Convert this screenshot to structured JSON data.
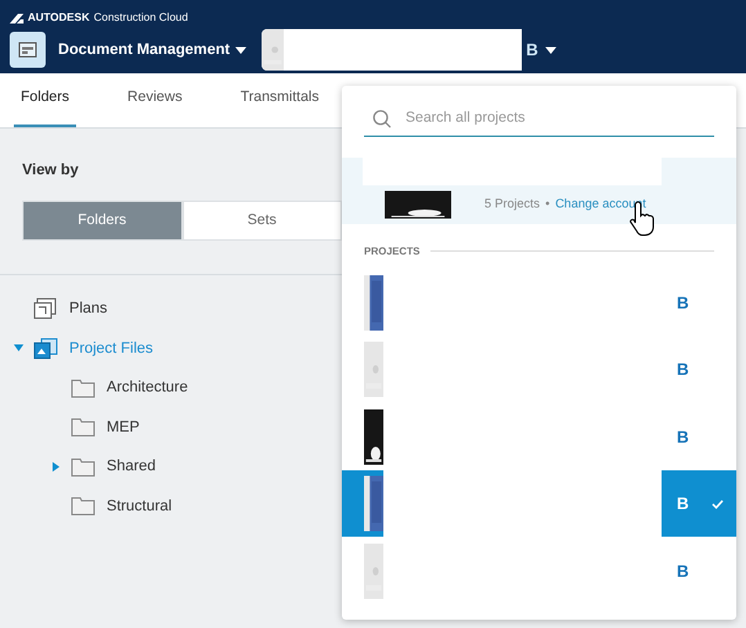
{
  "header": {
    "brand": "AUTODESK",
    "product": "Construction Cloud",
    "module": "Document Management",
    "project_name": "B"
  },
  "tabs": [
    {
      "label": "Folders",
      "selected": true
    },
    {
      "label": "Reviews",
      "selected": false
    },
    {
      "label": "Transmittals",
      "selected": false
    }
  ],
  "view_by": {
    "label": "View by",
    "options": [
      {
        "label": "Folders",
        "selected": true
      },
      {
        "label": "Sets",
        "selected": false
      }
    ]
  },
  "tree": [
    {
      "kind": "plans",
      "label": "Plans",
      "selected": false
    },
    {
      "kind": "files",
      "label": "Project Files",
      "selected": true,
      "expanded": true,
      "children": [
        {
          "kind": "folder",
          "label": "Architecture",
          "selected": false
        },
        {
          "kind": "folder",
          "label": "MEP",
          "selected": false
        },
        {
          "kind": "folder",
          "label": "Shared",
          "selected": false,
          "expanded": false
        },
        {
          "kind": "folder",
          "label": "Structural",
          "selected": false
        }
      ]
    }
  ],
  "dropdown": {
    "search": {
      "placeholder": "Search all projects"
    },
    "account": {
      "projects": "5 Projects",
      "separator": "•",
      "link": "Change account"
    },
    "section": "PROJECTS",
    "projects": [
      {
        "badge": "B",
        "selected": false
      },
      {
        "badge": "B",
        "selected": false
      },
      {
        "badge": "B",
        "selected": false
      },
      {
        "badge": "B",
        "selected": true
      },
      {
        "badge": "B",
        "selected": false
      }
    ]
  }
}
